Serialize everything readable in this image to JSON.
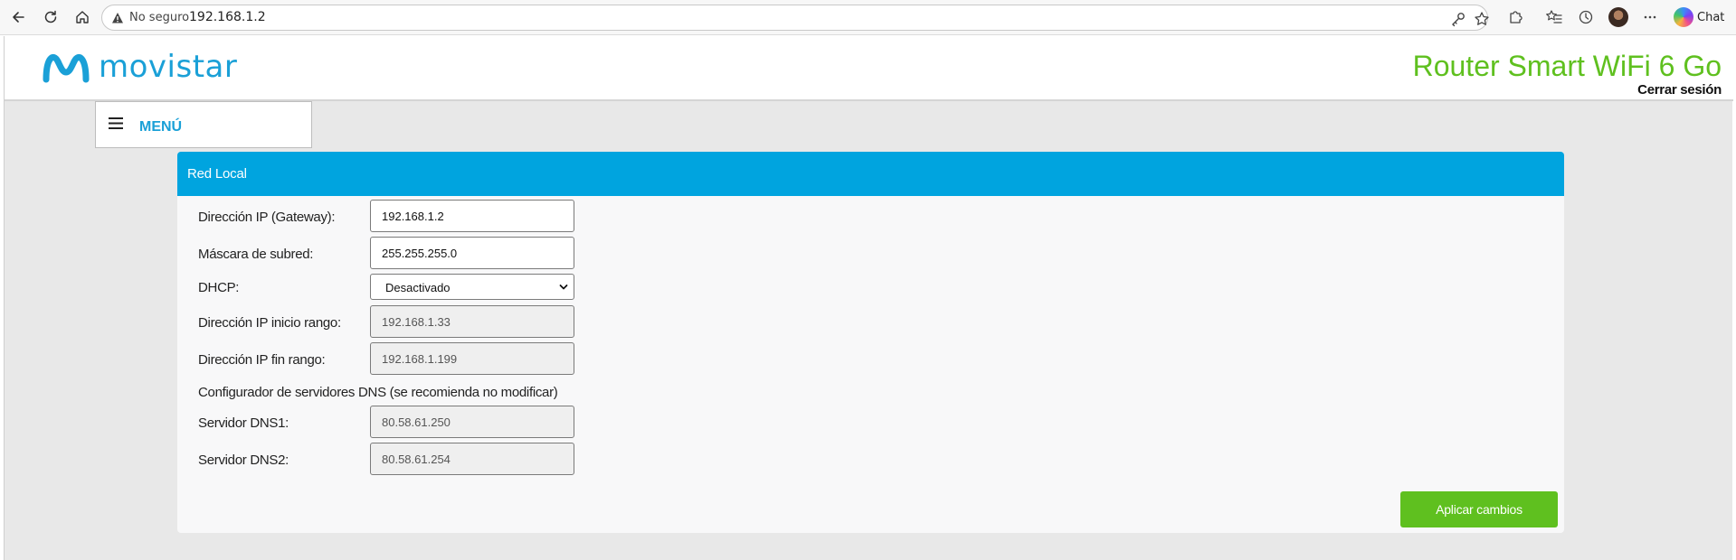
{
  "browser": {
    "not_secure_label": "No seguro",
    "url": "192.168.1.2",
    "chat_label": "Chat"
  },
  "header": {
    "logo_text": "movistar",
    "router_title": "Router Smart WiFi 6 Go",
    "logout_label": "Cerrar sesión",
    "logo_color": "#1aa0d7",
    "title_color": "#5fc01f"
  },
  "menu": {
    "label": "MENÚ"
  },
  "panel": {
    "title": "Red Local",
    "header_color": "#00a4df",
    "fields": {
      "gateway_label": "Dirección IP (Gateway):",
      "gateway_value": "192.168.1.2",
      "subnet_label": "Máscara de subred:",
      "subnet_value": "255.255.255.0",
      "dhcp_label": "DHCP:",
      "dhcp_value": "Desactivado",
      "range_start_label": "Dirección IP inicio rango:",
      "range_start_value": "192.168.1.33",
      "range_end_label": "Dirección IP fin rango:",
      "range_end_value": "192.168.1.199",
      "dns_heading": "Configurador de servidores DNS (se recomienda no modificar)",
      "dns1_label": "Servidor DNS1:",
      "dns1_value": "80.58.61.250",
      "dns2_label": "Servidor DNS2:",
      "dns2_value": "80.58.61.254"
    },
    "apply_label": "Aplicar cambios",
    "apply_color": "#5fc01f"
  }
}
